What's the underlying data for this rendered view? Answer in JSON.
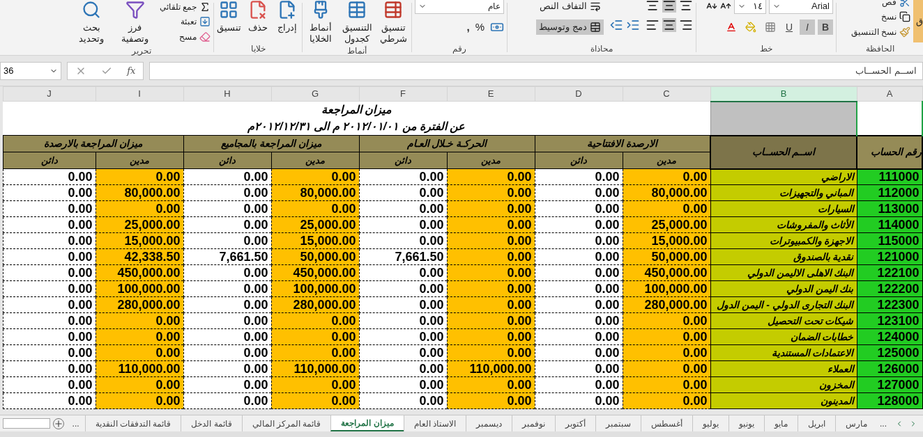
{
  "ribbon": {
    "groups": [
      {
        "label": "الحافظة",
        "items": [
          {
            "label": "ق"
          },
          {
            "label": "قص"
          },
          {
            "label": "نسخ"
          },
          {
            "label": "نسخ التنسيق"
          }
        ]
      },
      {
        "label": "خط",
        "font": "Arial",
        "size": "١٤",
        "format_buttons": [
          {
            "label": "B",
            "selected": true
          },
          {
            "label": "I",
            "selected": true
          },
          {
            "label": "U",
            "selected": false
          }
        ]
      },
      {
        "label": "محاذاة",
        "items": [
          {
            "label": "التفاف النص",
            "selected": false
          },
          {
            "label": "دمج وتوسيط",
            "selected": true
          }
        ],
        "center_selected": true
      },
      {
        "label": "رقم",
        "format": "عام",
        "symbols": [
          "%",
          ","
        ]
      },
      {
        "label": "أنماط",
        "items": [
          {
            "label": "تنسيق شرطي"
          },
          {
            "label": "التنسيق كجدول"
          },
          {
            "label": "أنماط الخلايا"
          }
        ]
      },
      {
        "label": "خلايا",
        "items": [
          {
            "label": "إدراج"
          },
          {
            "label": "حذف"
          },
          {
            "label": "تنسيق"
          }
        ]
      },
      {
        "label": "تحرير",
        "items": [
          {
            "label": "جمع تلقائي"
          },
          {
            "label": "تعبئة"
          },
          {
            "label": "مسح"
          },
          {
            "label": "فرز وتصفية"
          },
          {
            "label": "بحث وتحديد"
          }
        ]
      }
    ]
  },
  "formula_bar": {
    "name_box": "36",
    "function_label": "fx",
    "content": "اســم الحســاب"
  },
  "columns": [
    {
      "label": "A",
      "selected": false
    },
    {
      "label": "B",
      "selected": true
    },
    {
      "label": "C",
      "selected": false
    },
    {
      "label": "D",
      "selected": false
    },
    {
      "label": "E",
      "selected": false
    },
    {
      "label": "F",
      "selected": false
    },
    {
      "label": "G",
      "selected": false
    },
    {
      "label": "H",
      "selected": false
    },
    {
      "label": "I",
      "selected": false
    },
    {
      "label": "J",
      "selected": false
    }
  ],
  "sheet": {
    "title": "ميزان المراجعة",
    "subtitle": "عن الفترة من ٢٠١٢/٠١/٠١ م  الى  ٢٠١٢/١٢/٣١م",
    "number_header": "رقم الحساب",
    "name_header": "اســم الحســاب",
    "groups": [
      "الارصدة الافتتاحية",
      "الحركـة خـلال العـام",
      "ميزان المراجعة بالمجاميع",
      "ميزان المراجعة بالارصدة"
    ],
    "subheaders": [
      {
        "label": "مدين",
        "kind": "debit"
      },
      {
        "label": "دائن",
        "kind": "credit"
      },
      {
        "label": "مدين",
        "kind": "debit"
      },
      {
        "label": "دائن",
        "kind": "credit"
      },
      {
        "label": "مدين",
        "kind": "debit"
      },
      {
        "label": "دائن",
        "kind": "credit"
      },
      {
        "label": "مدين",
        "kind": "debit"
      },
      {
        "label": "دائن",
        "kind": "credit"
      }
    ],
    "rows": [
      {
        "number": "111000",
        "name": "الاراضي",
        "values": [
          "0.00",
          "0.00",
          "0.00",
          "0.00",
          "0.00",
          "0.00",
          "0.00",
          "0.00"
        ]
      },
      {
        "number": "112000",
        "name": "المباني والتجهيزات",
        "values": [
          "80,000.00",
          "0.00",
          "0.00",
          "0.00",
          "80,000.00",
          "0.00",
          "80,000.00",
          "0.00"
        ]
      },
      {
        "number": "113000",
        "name": "السيارات",
        "values": [
          "0.00",
          "0.00",
          "0.00",
          "0.00",
          "0.00",
          "0.00",
          "0.00",
          "0.00"
        ]
      },
      {
        "number": "114000",
        "name": "الأثاث والمفروشات",
        "values": [
          "25,000.00",
          "0.00",
          "0.00",
          "0.00",
          "25,000.00",
          "0.00",
          "25,000.00",
          "0.00"
        ]
      },
      {
        "number": "115000",
        "name": "الاجهزة والكمبيوترات",
        "values": [
          "15,000.00",
          "0.00",
          "0.00",
          "0.00",
          "15,000.00",
          "0.00",
          "15,000.00",
          "0.00"
        ]
      },
      {
        "number": "121000",
        "name": "نقدية بالصندوق",
        "values": [
          "50,000.00",
          "0.00",
          "0.00",
          "7,661.50",
          "50,000.00",
          "7,661.50",
          "42,338.50",
          "0.00"
        ]
      },
      {
        "number": "122100",
        "name": "البنك الاهلى الاليمن الدولي",
        "values": [
          "450,000.00",
          "0.00",
          "0.00",
          "0.00",
          "450,000.00",
          "0.00",
          "450,000.00",
          "0.00"
        ]
      },
      {
        "number": "122200",
        "name": "بنك اليمن الدولي",
        "values": [
          "100,000.00",
          "0.00",
          "0.00",
          "0.00",
          "100,000.00",
          "0.00",
          "100,000.00",
          "0.00"
        ]
      },
      {
        "number": "122300",
        "name": "البنك التجارى الدولي - اليمن الدول",
        "values": [
          "280,000.00",
          "0.00",
          "0.00",
          "0.00",
          "280,000.00",
          "0.00",
          "280,000.00",
          "0.00"
        ]
      },
      {
        "number": "123100",
        "name": "شيكات تحت التحصيل",
        "values": [
          "0.00",
          "0.00",
          "0.00",
          "0.00",
          "0.00",
          "0.00",
          "0.00",
          "0.00"
        ]
      },
      {
        "number": "124000",
        "name": "خطابات الضمان",
        "values": [
          "0.00",
          "0.00",
          "0.00",
          "0.00",
          "0.00",
          "0.00",
          "0.00",
          "0.00"
        ]
      },
      {
        "number": "125000",
        "name": "الاعتمادات المستندية",
        "values": [
          "0.00",
          "0.00",
          "0.00",
          "0.00",
          "0.00",
          "0.00",
          "0.00",
          "0.00"
        ]
      },
      {
        "number": "126000",
        "name": "العملاء",
        "values": [
          "0.00",
          "0.00",
          "110,000.00",
          "0.00",
          "110,000.00",
          "0.00",
          "110,000.00",
          "0.00"
        ]
      },
      {
        "number": "127000",
        "name": "المخزون",
        "values": [
          "0.00",
          "0.00",
          "0.00",
          "0.00",
          "0.00",
          "0.00",
          "0.00",
          "0.00"
        ]
      },
      {
        "number": "128000",
        "name": "المدينون",
        "values": [
          "0.00",
          "0.00",
          "0.00",
          "0.00",
          "0.00",
          "0.00",
          "0.00",
          "0.00"
        ]
      }
    ]
  },
  "sheet_tabs": {
    "more_right": "...",
    "more_left": "...",
    "tabs": [
      {
        "label": "مارس",
        "selected": false
      },
      {
        "label": "ابريل",
        "selected": false
      },
      {
        "label": "مايو",
        "selected": false
      },
      {
        "label": "يونيو",
        "selected": false
      },
      {
        "label": "يوليو",
        "selected": false
      },
      {
        "label": "أغسطس",
        "selected": false
      },
      {
        "label": "سبتمبر",
        "selected": false
      },
      {
        "label": "أكتوبر",
        "selected": false
      },
      {
        "label": "نوفمبر",
        "selected": false
      },
      {
        "label": "ديسمبر",
        "selected": false
      },
      {
        "label": "الاستاذ العام",
        "selected": false
      },
      {
        "label": "ميزان المراجعة",
        "selected": true
      },
      {
        "label": "قائمة المركز المالي",
        "selected": false
      },
      {
        "label": "قائمة الدخل",
        "selected": false
      },
      {
        "label": "قائمة التدفقات النقدية",
        "selected": false
      }
    ]
  }
}
